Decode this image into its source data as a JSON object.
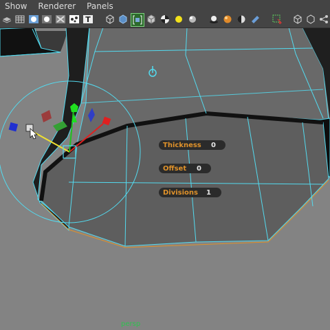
{
  "menu": [
    "Show",
    "Renderer",
    "Panels"
  ],
  "toolbar_icons": [
    "layers-icon",
    "grid-icon",
    "shaded-icon",
    "smooth-shade-icon",
    "xray-icon",
    "joints-icon",
    "texture-icon",
    "wireframe-cube-icon",
    "solid-cube-icon",
    "isolate-select-icon",
    "textured-cube-icon",
    "checker-icon",
    "light-bulb-icon",
    "sphere-icon",
    "shadows-icon",
    "ambient-occlusion-icon",
    "motion-blur-icon",
    "camera-icon",
    "select-tool-icon",
    "cube-frame-icon",
    "cube-outline-icon",
    "share-icon"
  ],
  "hud": {
    "thickness": {
      "label": "Thickness",
      "value": "0"
    },
    "offset": {
      "label": "Offset",
      "value": "0"
    },
    "divisions": {
      "label": "Divisions",
      "value": "1"
    }
  },
  "camera": "persp",
  "colors": {
    "wire": "#53dbf0",
    "hud_label": "#e0922a",
    "camera_label": "#2ec24f",
    "viewport_bg": "#838383"
  }
}
